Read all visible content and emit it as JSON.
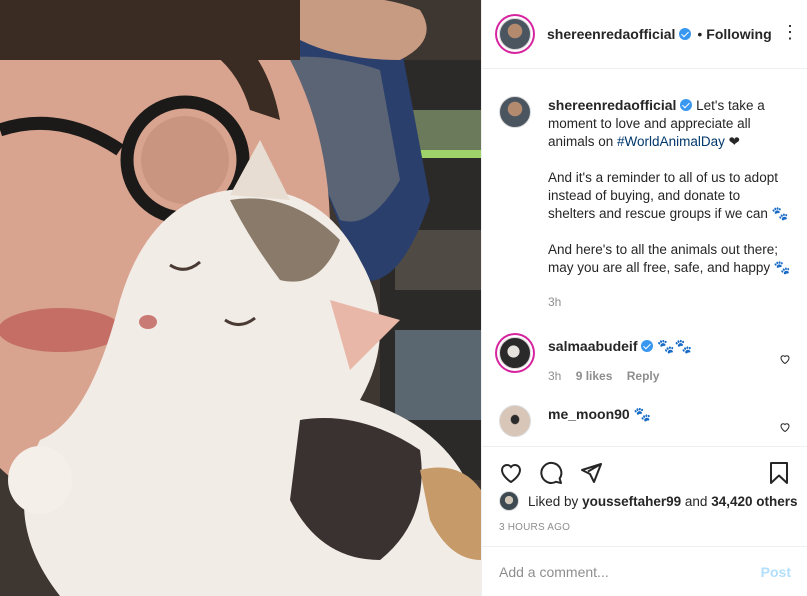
{
  "header": {
    "username": "shereenredaofficial",
    "separator": "•",
    "follow_status": "Following",
    "more": "⋮"
  },
  "caption": {
    "username": "shereenredaofficial",
    "line1_pre": "Let's take a moment to love and appreciate all animals on ",
    "hashtag": "#WorldAnimalDay",
    "line1_post": " ❤",
    "para2": "And it's a reminder to all of us to adopt instead of buying, and donate to shelters and rescue groups if we can 🐾",
    "para3": "And here's to all the animals out there; may you are all free, safe, and happy 🐾",
    "time": "3h"
  },
  "comments": [
    {
      "username": "salmaabudeif",
      "text": "🐾🐾",
      "time": "3h",
      "likes": "9 likes",
      "reply": "Reply"
    },
    {
      "username": "me_moon90",
      "text": "🐾"
    }
  ],
  "likes": {
    "prefix": "Liked by ",
    "user": "yousseftaher99",
    "middle": " and ",
    "count": "34,420 others"
  },
  "date": "3 HOURS AGO",
  "add_comment": {
    "placeholder": "Add a comment...",
    "post_label": "Post"
  },
  "icons": {
    "like": "heart-icon",
    "comment": "comment-icon",
    "share": "paper-plane-icon",
    "save": "bookmark-icon"
  },
  "colors": {
    "verified": "#3897f0",
    "hashtag": "#00376b",
    "post_disabled": "#b2dffc",
    "muted": "#8e8e8e"
  }
}
